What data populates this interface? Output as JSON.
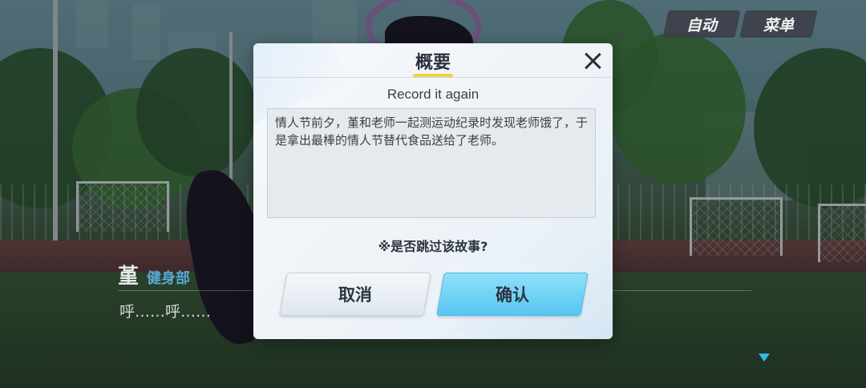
{
  "top_buttons": {
    "auto": "自动",
    "menu": "菜单"
  },
  "dialogue": {
    "speaker": "堇",
    "affiliation": "健身部",
    "text": "呼……呼……"
  },
  "modal": {
    "title": "概要",
    "episode_title": "Record it again",
    "summary": "情人节前夕，堇和老师一起测运动纪录时发现老师饿了，于是拿出最棒的情人节替代食品送给了老师。",
    "question": "※是否跳过该故事?",
    "cancel_label": "取消",
    "confirm_label": "确认"
  },
  "colors": {
    "accent_blue": "#57c6f1",
    "title_underline": "#f2d43a",
    "affiliation": "#5aa9d8"
  },
  "icons": [
    "close-icon",
    "next-arrow-icon"
  ]
}
